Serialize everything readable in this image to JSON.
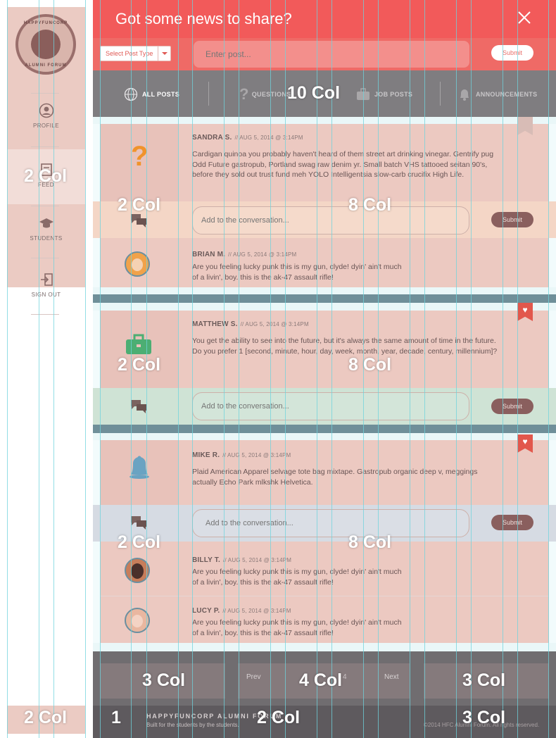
{
  "logo": {
    "top_text": "HAPPYFUNCORP",
    "bottom_text": "ALUMNI FORUM"
  },
  "sidebar": {
    "items": [
      {
        "label": "PROFILE",
        "icon": "user-circle-icon"
      },
      {
        "label": "FEED",
        "icon": "feed-icon"
      },
      {
        "label": "STUDENTS",
        "icon": "graduation-cap-icon"
      },
      {
        "label": "SIGN OUT",
        "icon": "sign-out-icon"
      }
    ]
  },
  "header": {
    "title": "Got some news to share?",
    "post_type_label": "Select Post Type",
    "post_placeholder": "Enter post...",
    "submit_label": "Submit"
  },
  "tabs": [
    {
      "label": "ALL POSTS",
      "icon": "globe-icon"
    },
    {
      "label": "QUESTIONS",
      "icon": "question-icon"
    },
    {
      "label": "JOB POSTS",
      "icon": "briefcase-icon"
    },
    {
      "label": "ANNOUNCEMENTS",
      "icon": "bell-icon"
    }
  ],
  "posts": [
    {
      "category_icon": "question-mark-icon",
      "author": "SANDRA S.",
      "meta": "// AUG 5, 2014 @ 3:14PM",
      "body": "Cardigan quinoa you probably haven't heard of them street art drinking vinegar. Gentrify pug Odd Future gastropub, Portland swag raw denim yr. Small batch VHS tattooed seitan 90's, before they sold out trust fund meh YOLO Intelligentsia slow-carb crucifix High Life.",
      "reply_placeholder": "Add to the conversation...",
      "reply_submit": "Submit",
      "comments": [
        {
          "author": "BRIAN M.",
          "meta": "// AUG 5, 2014 @ 3:14PM",
          "line1": "Are you feeling lucky punk this is my gun, clyde! dyin' ain't much",
          "line2": "of a livin', boy. this is the ak-47 assault rifle!"
        }
      ]
    },
    {
      "category_icon": "briefcase-icon",
      "author": "MATTHEW S.",
      "meta": "// AUG 5, 2014 @ 3:14PM",
      "body": "You get the ability to see into the future, but it's always the same amount of time in the future. Do you prefer 1 [second, minute, hour, day, week, month, year, decade, century, millennium]?",
      "reply_placeholder": "Add to the conversation...",
      "reply_submit": "Submit"
    },
    {
      "category_icon": "bell-icon",
      "author": "MIKE R.",
      "meta": "// AUG 5, 2014 @ 3:14PM",
      "body": "Plaid American Apparel selvage tote bag mixtape. Gastropub organic deep v, meggings actually Echo Park mlkshk Helvetica.",
      "reply_placeholder": "Add to the conversation...",
      "reply_submit": "Submit",
      "comments": [
        {
          "author": "BILLY T.",
          "meta": "// AUG 5, 2014 @ 3:14PM",
          "line1": "Are you feeling lucky punk this is my gun, clyde! dyin' ain't much",
          "line2": "of a livin', boy. this is the ak-47 assault rifle!"
        },
        {
          "author": "LUCY P.",
          "meta": "// AUG 5, 2014 @ 3:14PM",
          "line1": "Are you feeling lucky punk this is my gun, clyde! dyin' ain't much",
          "line2": "of a livin', boy. this is the ak-47 assault rifle!"
        }
      ]
    }
  ],
  "pagination": {
    "prev": "Prev",
    "page": "4",
    "next": "Next"
  },
  "footer": {
    "title": "HAPPYFUNCORP ALUMNI FORUM",
    "subtitle": "Built for the students by the students.",
    "copyright": "©2014 HFC Alumni Forum. All rights reserved."
  },
  "overlay_labels": {
    "ten_col": "10 Col",
    "two_col": "2 Col",
    "eight_col": "8 Col",
    "three_col": "3 Col",
    "four_col": "4 Col",
    "one": "1"
  },
  "colors": {
    "header": "#f25a5a",
    "overlay_pink": "#ecc9c1",
    "grid_line": "#6fd3dc",
    "tabs_bar": "#7f7d80",
    "question_orange": "#f0932b",
    "briefcase_green": "#4cae73",
    "bell_blue": "#6aa3c2",
    "bookmark_red": "#e2574c"
  }
}
